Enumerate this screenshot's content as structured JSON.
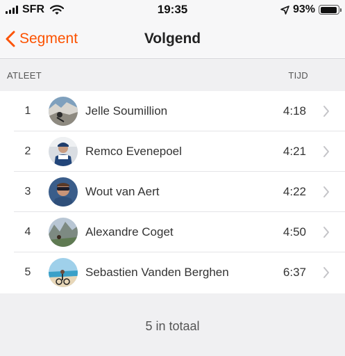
{
  "status_bar": {
    "carrier": "SFR",
    "time": "19:35",
    "battery_percent": "93%",
    "battery_level": 0.93,
    "icons": [
      "signal-icon",
      "wifi-icon",
      "location-arrow-icon",
      "battery-icon"
    ]
  },
  "nav": {
    "back_label": "Segment",
    "title": "Volgend"
  },
  "columns": {
    "athlete": "ATLEET",
    "time": "TIJD"
  },
  "leaderboard": [
    {
      "rank": "1",
      "name": "Jelle Soumillion",
      "time": "4:18"
    },
    {
      "rank": "2",
      "name": "Remco Evenepoel",
      "time": "4:21"
    },
    {
      "rank": "3",
      "name": "Wout van Aert",
      "time": "4:22"
    },
    {
      "rank": "4",
      "name": "Alexandre Coget",
      "time": "4:50"
    },
    {
      "rank": "5",
      "name": "Sebastien Vanden Berghen",
      "time": "6:37"
    }
  ],
  "footer": {
    "total": "5 in totaal"
  },
  "colors": {
    "accent": "#fc5200",
    "background": "#f7f7f8",
    "list_background": "#ffffff"
  }
}
